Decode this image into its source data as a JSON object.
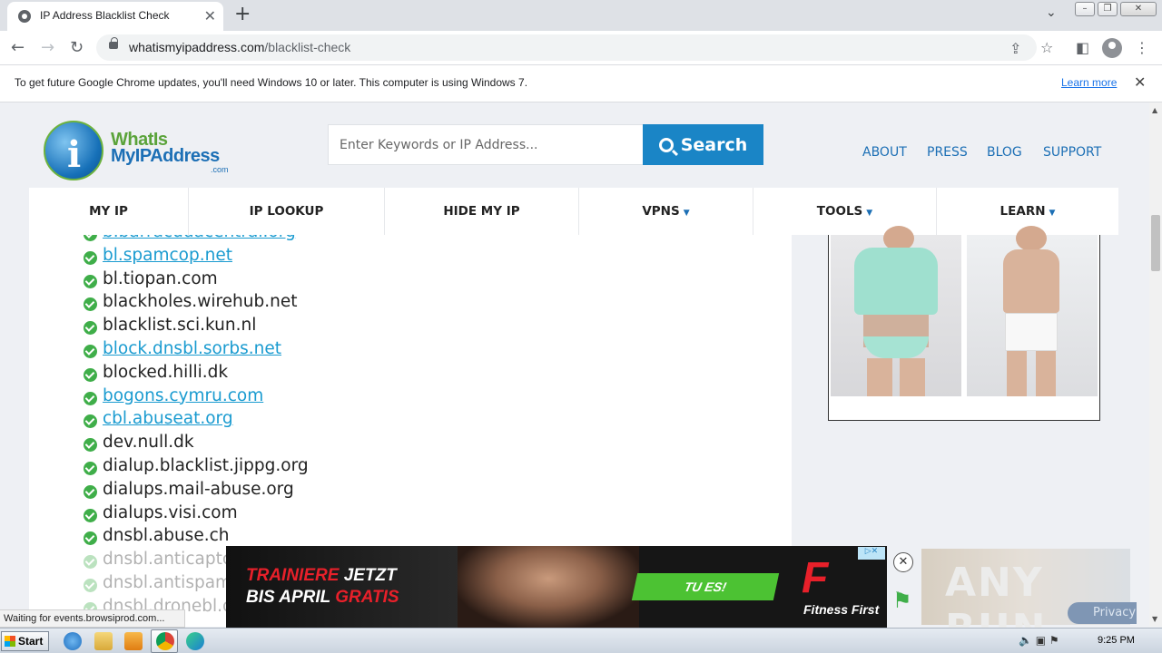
{
  "browser": {
    "tab_title": "IP Address Blacklist Check",
    "url_host": "whatismyipaddress.com",
    "url_path": "/blacklist-check",
    "infobar_message": "To get future Google Chrome updates, you'll need Windows 10 or later. This computer is using Windows 7.",
    "infobar_link": "Learn more",
    "status_text": "Waiting for events.browsiprod.com..."
  },
  "site": {
    "logo_line1": "WhatIs",
    "logo_line2": "MyIPAddress",
    "logo_line3": ".com",
    "search_placeholder": "Enter Keywords or IP Address...",
    "search_button": "Search",
    "top_links": [
      "ABOUT",
      "PRESS",
      "BLOG",
      "SUPPORT"
    ],
    "nav": [
      {
        "label": "MY IP",
        "caret": false
      },
      {
        "label": "IP LOOKUP",
        "caret": false
      },
      {
        "label": "HIDE MY IP",
        "caret": false
      },
      {
        "label": "VPNS",
        "caret": true
      },
      {
        "label": "TOOLS",
        "caret": true
      },
      {
        "label": "LEARN",
        "caret": true
      }
    ]
  },
  "blacklist": [
    {
      "name": "b.barracudacentral.org",
      "link": true
    },
    {
      "name": "bl.spamcop.net",
      "link": true
    },
    {
      "name": "bl.tiopan.com",
      "link": false
    },
    {
      "name": "blackholes.wirehub.net",
      "link": false
    },
    {
      "name": "blacklist.sci.kun.nl",
      "link": false
    },
    {
      "name": "block.dnsbl.sorbs.net",
      "link": true
    },
    {
      "name": "blocked.hilli.dk",
      "link": false
    },
    {
      "name": "bogons.cymru.com",
      "link": true
    },
    {
      "name": "cbl.abuseat.org",
      "link": true
    },
    {
      "name": "dev.null.dk",
      "link": false
    },
    {
      "name": "dialup.blacklist.jippg.org",
      "link": false
    },
    {
      "name": "dialups.mail-abuse.org",
      "link": false
    },
    {
      "name": "dialups.visi.com",
      "link": false
    },
    {
      "name": "dnsbl.abuse.ch",
      "link": false
    },
    {
      "name": "dnsbl.anticaptcha.net",
      "link": false
    },
    {
      "name": "dnsbl.antispam.or.id",
      "link": false
    },
    {
      "name": "dnsbl.dronebl.org",
      "link": false
    }
  ],
  "bottom_ad": {
    "line1_red": "TRAINIERE",
    "line1_white": "JETZT",
    "line2_white": "BIS APRIL",
    "line2_red": "GRATIS",
    "cta": "TU ES!",
    "brand_mark": "F",
    "brand_name": "Fitness First",
    "adchoices": "▷✕"
  },
  "overlay": {
    "watermark": "ANY RUN",
    "privacy": "Privacy"
  },
  "taskbar": {
    "start": "Start",
    "clock": "9:25 PM"
  }
}
